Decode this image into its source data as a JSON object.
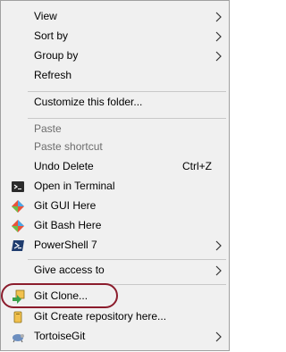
{
  "menu": {
    "items": [
      {
        "label": "View",
        "submenu": true
      },
      {
        "label": "Sort by",
        "submenu": true
      },
      {
        "label": "Group by",
        "submenu": true
      },
      {
        "label": "Refresh"
      },
      {
        "label": "Customize this folder..."
      },
      {
        "label": "Paste",
        "disabled": true
      },
      {
        "label": "Paste shortcut",
        "disabled": true
      },
      {
        "label": "Undo Delete",
        "shortcut": "Ctrl+Z"
      },
      {
        "label": "Open in Terminal",
        "icon": "terminal-icon"
      },
      {
        "label": "Git GUI Here",
        "icon": "git-gui-icon"
      },
      {
        "label": "Git Bash Here",
        "icon": "git-bash-icon"
      },
      {
        "label": "PowerShell 7",
        "icon": "powershell-icon",
        "submenu": true
      },
      {
        "label": "Give access to",
        "submenu": true
      },
      {
        "label": "Git Clone...",
        "icon": "tortoisegit-clone-icon",
        "highlighted_annotation": true
      },
      {
        "label": "Git Create repository here...",
        "icon": "tortoisegit-create-repo-icon"
      },
      {
        "label": "TortoiseGit",
        "icon": "tortoisegit-icon",
        "submenu": true
      }
    ]
  },
  "colors": {
    "menu_bg": "#f0f0f0",
    "menu_border": "#a0a0a0",
    "separator": "#c8c8c8",
    "disabled_text": "#6d6d6d",
    "annotation_ring": "#8b1c2c"
  }
}
